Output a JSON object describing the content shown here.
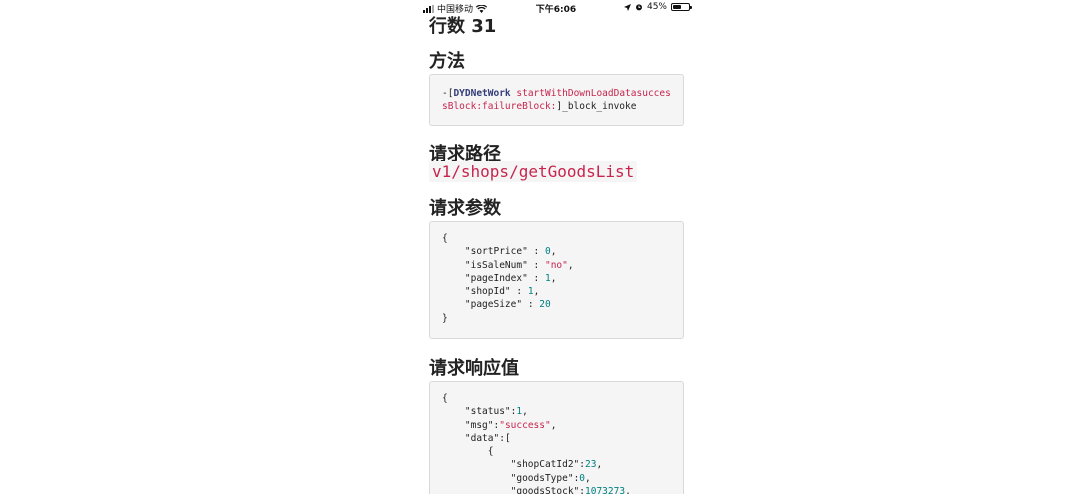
{
  "status_bar": {
    "carrier": "中国移动",
    "time": "下午6:06",
    "battery": "45%",
    "battery_level": 0.45
  },
  "row": {
    "heading": "行数 31"
  },
  "method": {
    "heading": "方法",
    "prefix": "-[",
    "class_name": "DYDNetWork",
    "selector": "startWithDownLoadDatasuccessBlock:failureBlock:",
    "suffix": "]_block_invoke"
  },
  "path": {
    "heading": "请求路径",
    "value": "v1/shops/getGoodsList"
  },
  "params": {
    "heading": "请求参数",
    "open": "{",
    "close": "}",
    "lines": [
      {
        "key": "\"sortPrice\"",
        "sep": " : ",
        "value": "0",
        "type": "num",
        "comma": ","
      },
      {
        "key": "\"isSaleNum\"",
        "sep": " : ",
        "value": "\"no\"",
        "type": "str",
        "comma": ","
      },
      {
        "key": "\"pageIndex\"",
        "sep": " : ",
        "value": "1",
        "type": "num",
        "comma": ","
      },
      {
        "key": "\"shopId\"",
        "sep": " : ",
        "value": "1",
        "type": "num",
        "comma": ","
      },
      {
        "key": "\"pageSize\"",
        "sep": " : ",
        "value": "20",
        "type": "num",
        "comma": ""
      }
    ]
  },
  "response": {
    "heading": "请求响应值",
    "open": "{",
    "status_key": "\"status\"",
    "status_value": "1",
    "msg_key": "\"msg\"",
    "msg_value": "\"success\"",
    "data_key": "\"data\"",
    "data_open": "[",
    "item_open": "{",
    "item_lines": [
      {
        "key": "\"shopCatId2\"",
        "value": "23",
        "comma": ","
      },
      {
        "key": "\"goodsType\"",
        "value": "0",
        "comma": ","
      },
      {
        "key": "\"goodsStock\"",
        "value": "1073273",
        "comma": ","
      }
    ]
  }
}
